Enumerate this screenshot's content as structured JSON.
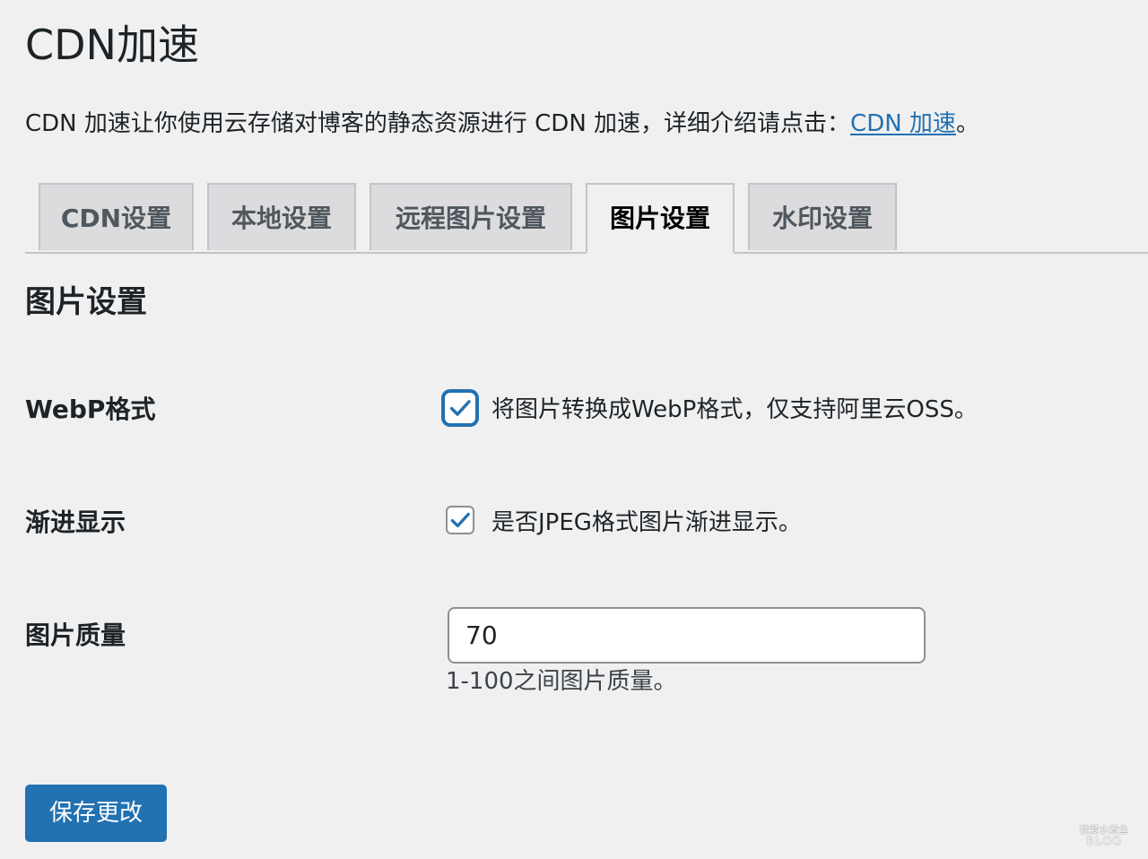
{
  "page": {
    "title": "CDN加速",
    "intro_text": "CDN 加速让你使用云存储对博客的静态资源进行 CDN 加速，详细介绍请点击：",
    "intro_link": "CDN 加速",
    "intro_suffix": "。"
  },
  "tabs": [
    {
      "label": "CDN设置",
      "active": false
    },
    {
      "label": "本地设置",
      "active": false
    },
    {
      "label": "远程图片设置",
      "active": false
    },
    {
      "label": "图片设置",
      "active": true
    },
    {
      "label": "水印设置",
      "active": false
    }
  ],
  "section": {
    "title": "图片设置"
  },
  "settings": {
    "webp": {
      "label": "WebP格式",
      "checked": true,
      "description": "将图片转换成WebP格式，仅支持阿里云OSS。"
    },
    "progressive": {
      "label": "渐进显示",
      "checked": true,
      "description": "是否JPEG格式图片渐进显示。"
    },
    "quality": {
      "label": "图片质量",
      "value": "70",
      "description": "1-100之间图片质量。"
    }
  },
  "actions": {
    "save_label": "保存更改"
  },
  "watermark": {
    "top": "我爱水煮鱼",
    "bottom": "BLOG"
  },
  "colors": {
    "accent": "#2271b1",
    "background": "#f0f0f1",
    "text": "#1d2327"
  },
  "icons": {
    "checkbox": "check-icon"
  }
}
